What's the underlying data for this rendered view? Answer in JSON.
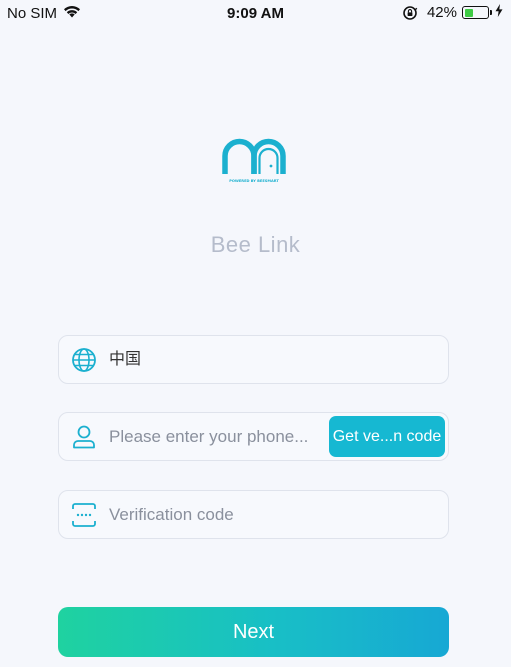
{
  "status_bar": {
    "carrier": "No SIM",
    "time": "9:09 AM",
    "battery_percent": "42%",
    "battery_level": 0.42
  },
  "app": {
    "title": "Bee Link",
    "logo_caption": "POWERED BY BEESMART"
  },
  "form": {
    "region_value": "中国",
    "phone_placeholder": "Please enter your phone...",
    "get_code_label": "Get ve...n code",
    "code_placeholder": "Verification code",
    "next_label": "Next"
  },
  "colors": {
    "accent": "#16b8d2",
    "next_gradient_start": "#1fd2a0",
    "next_gradient_end": "#17a8d4",
    "title": "#b5bccb"
  },
  "icons": {
    "region": "globe-icon",
    "phone": "user-icon",
    "code": "verification-code-icon"
  }
}
